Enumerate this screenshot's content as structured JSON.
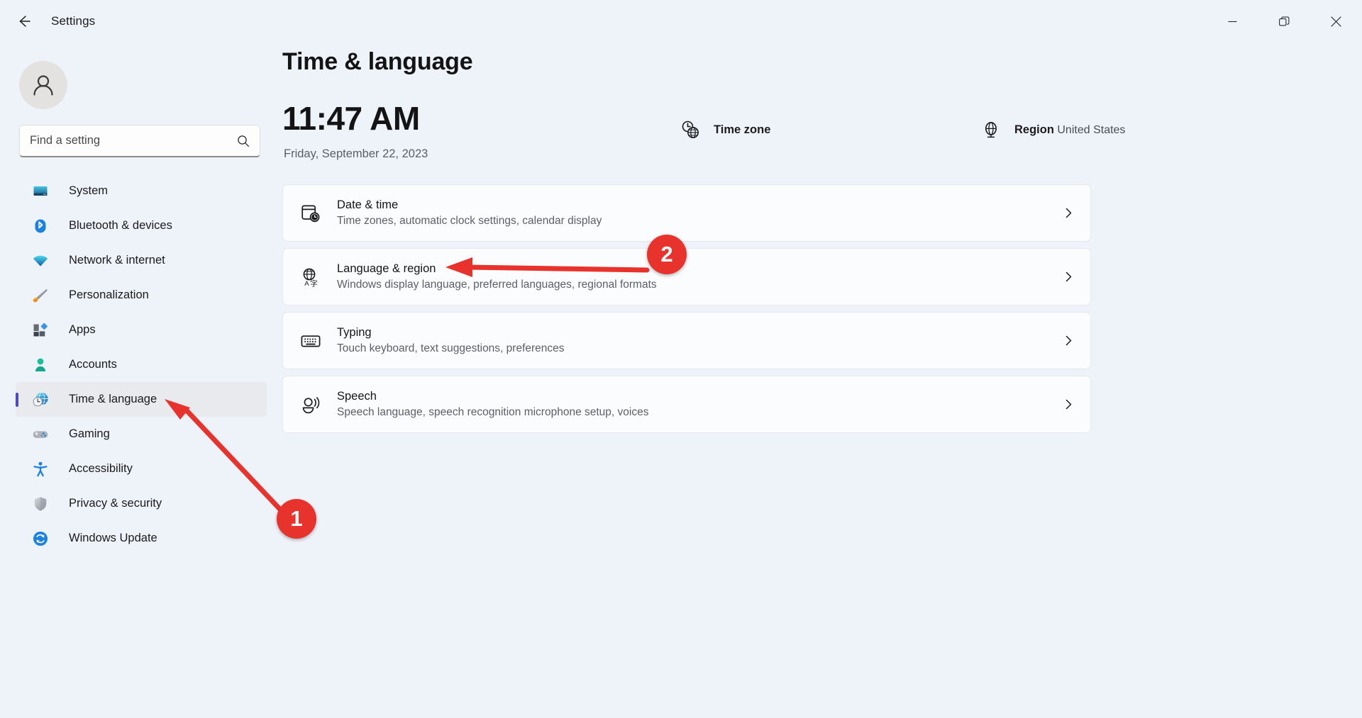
{
  "titlebar": {
    "back_label": "back-arrow",
    "app_title": "Settings",
    "minimize": "minimize-icon",
    "restore": "restore-icon",
    "close": "close-icon"
  },
  "sidebar": {
    "avatar_alt": "user-avatar",
    "search": {
      "placeholder": "Find a setting",
      "value": "",
      "icon": "search-icon"
    },
    "items": [
      {
        "label": "System",
        "icon": "monitor-icon",
        "selected": false
      },
      {
        "label": "Bluetooth & devices",
        "icon": "bluetooth-icon",
        "selected": false
      },
      {
        "label": "Network & internet",
        "icon": "wifi-icon",
        "selected": false
      },
      {
        "label": "Personalization",
        "icon": "paintbrush-icon",
        "selected": false
      },
      {
        "label": "Apps",
        "icon": "apps-icon",
        "selected": false
      },
      {
        "label": "Accounts",
        "icon": "person-icon",
        "selected": false
      },
      {
        "label": "Time & language",
        "icon": "clock-globe-icon",
        "selected": true
      },
      {
        "label": "Gaming",
        "icon": "gamepad-icon",
        "selected": false
      },
      {
        "label": "Accessibility",
        "icon": "accessibility-icon",
        "selected": false
      },
      {
        "label": "Privacy & security",
        "icon": "shield-icon",
        "selected": false
      },
      {
        "label": "Windows Update",
        "icon": "update-icon",
        "selected": false
      }
    ]
  },
  "main": {
    "page_title": "Time & language",
    "clock": {
      "time": "11:47 AM",
      "date": "Friday, September 22, 2023"
    },
    "status": [
      {
        "label": "Time zone",
        "value": "",
        "icon": "clock-globe-icon"
      },
      {
        "label": "Region",
        "value": "United States",
        "icon": "globe-icon"
      }
    ],
    "cards": [
      {
        "title": "Date & time",
        "subtitle": "Time zones, automatic clock settings, calendar display",
        "icon": "calendar-clock-icon",
        "chevron": "chevron-right-icon"
      },
      {
        "title": "Language & region",
        "subtitle": "Windows display language, preferred languages, regional formats",
        "icon": "translate-globe-icon",
        "chevron": "chevron-right-icon"
      },
      {
        "title": "Typing",
        "subtitle": "Touch keyboard, text suggestions, preferences",
        "icon": "keyboard-icon",
        "chevron": "chevron-right-icon"
      },
      {
        "title": "Speech",
        "subtitle": "Speech language, speech recognition microphone setup, voices",
        "icon": "speech-icon",
        "chevron": "chevron-right-icon"
      }
    ]
  },
  "annotations": {
    "color": "#e8322c",
    "badges": [
      {
        "label": "1"
      },
      {
        "label": "2"
      }
    ]
  },
  "colors": {
    "background": "#eef2f9",
    "card": "#fbfcfd",
    "accent": "#4949c9",
    "annotation_red": "#e8322c",
    "selected_row": "#e9eaee"
  }
}
